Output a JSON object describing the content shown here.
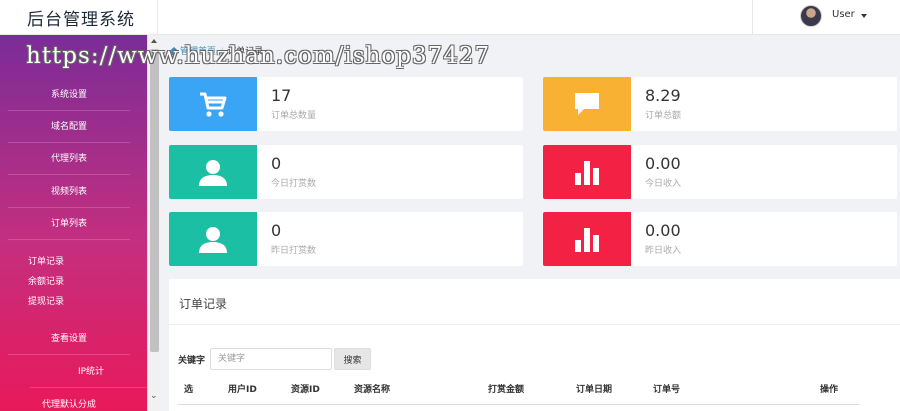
{
  "header": {
    "title": "后台管理系统",
    "user": "User"
  },
  "sidebar": {
    "items": [
      "系统设置",
      "域名配置",
      "代理列表",
      "视频列表",
      "订单列表"
    ],
    "sub_items": [
      "订单记录",
      "余额记录",
      "提现记录"
    ],
    "items_after": [
      "查看设置",
      "IP统计",
      "代理默认分成"
    ]
  },
  "breadcrumb": {
    "home": "管理首页",
    "current": "订单记录"
  },
  "watermark": "https://www.huzhan.com/ishop37427",
  "stats": [
    {
      "value": "17",
      "label": "订单总数量",
      "icon": "cart-icon",
      "color": "#3aa4f5"
    },
    {
      "value": "8.29",
      "label": "订单总额",
      "icon": "chat-icon",
      "color": "#f9b134"
    },
    {
      "value": "0",
      "label": "今日打赏数",
      "icon": "user-icon",
      "color": "#1bbfa3"
    },
    {
      "value": "0.00",
      "label": "今日收入",
      "icon": "bar-chart-icon",
      "color": "#f32244"
    },
    {
      "value": "0",
      "label": "昨日打赏数",
      "icon": "user-icon",
      "color": "#1bbfa3"
    },
    {
      "value": "0.00",
      "label": "昨日收入",
      "icon": "bar-chart-icon",
      "color": "#f32244"
    }
  ],
  "orders": {
    "title": "订单记录",
    "keyword_label": "关键字",
    "keyword_placeholder": "关键字",
    "search_button": "搜索",
    "columns": [
      "选",
      "用户ID",
      "资源ID",
      "资源名称",
      "打赏金额",
      "订单日期",
      "订单号",
      "操作"
    ]
  }
}
